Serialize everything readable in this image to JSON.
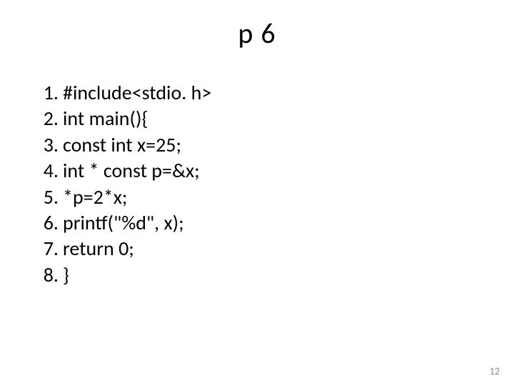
{
  "title": "p 6",
  "lines": [
    {
      "n": "1.",
      "code": "#include<stdio. h>"
    },
    {
      "n": "2.",
      "code": "int main(){"
    },
    {
      "n": "3.",
      "code": "const int x=25;"
    },
    {
      "n": "4.",
      "code": "int * const p=&x;"
    },
    {
      "n": "5.",
      "code": "*p=2*x;"
    },
    {
      "n": "6.",
      "code": "printf(\"%d\", x);"
    },
    {
      "n": "7.",
      "code": "return 0;"
    },
    {
      "n": "8.",
      "code": "}"
    }
  ],
  "page_number": "12"
}
